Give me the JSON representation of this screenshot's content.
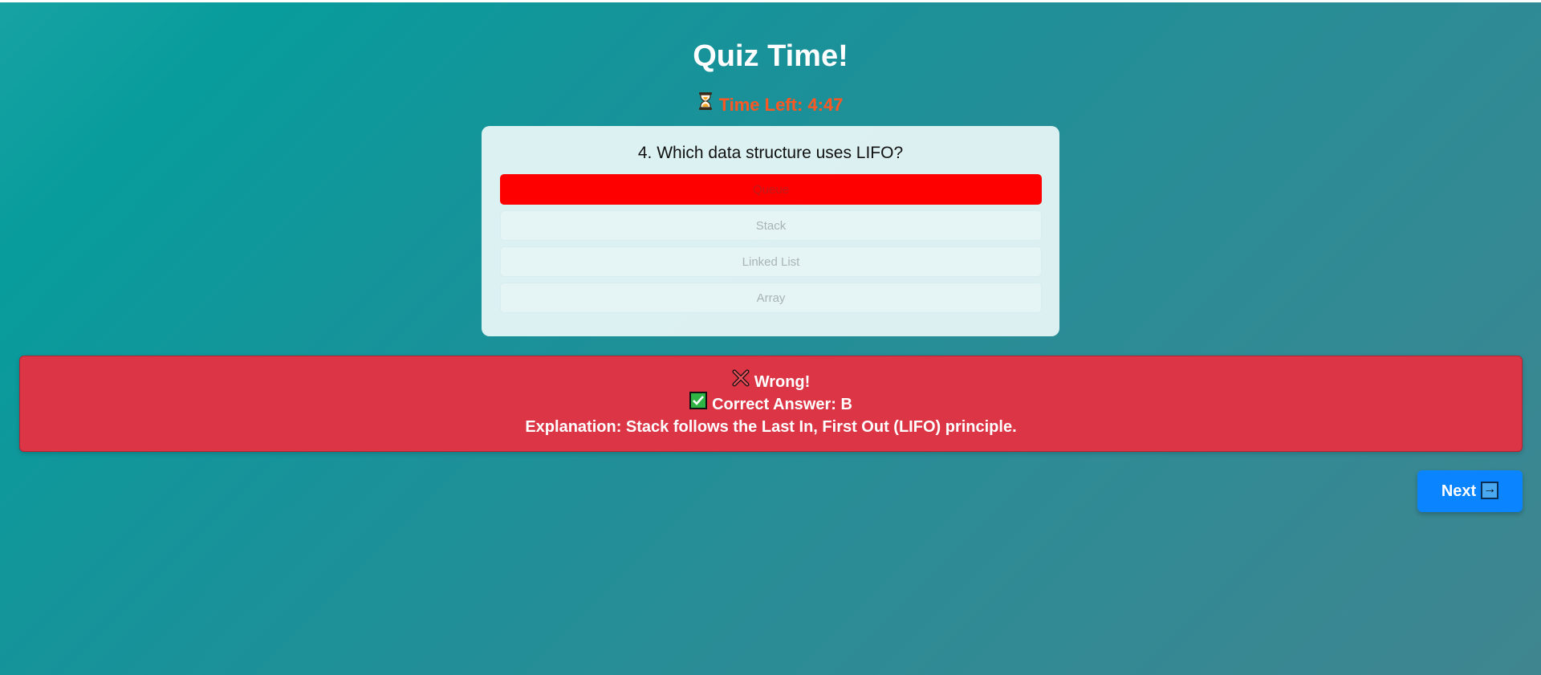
{
  "quiz": {
    "title": "Quiz Time!",
    "timer": {
      "icon": "hourglass-icon",
      "label": "Time Left: 4:47",
      "color": "#ff5722"
    },
    "question": {
      "text": "4. Which data structure uses LIFO?",
      "options": [
        {
          "label": "Queue",
          "selected": true
        },
        {
          "label": "Stack",
          "selected": false
        },
        {
          "label": "Linked List",
          "selected": false
        },
        {
          "label": "Array",
          "selected": false
        }
      ],
      "selected_color": "#ff0000"
    },
    "feedback": {
      "status_icon": "cross-icon",
      "status_text": "Wrong!",
      "correct_icon": "check-mark-icon",
      "correct_text": "Correct Answer: B",
      "explanation_label": "Explanation:",
      "explanation_text": "Stack follows the Last In, First Out (LIFO) principle.",
      "color": "#dc3545"
    },
    "next_button": {
      "label": "Next",
      "icon": "arrow-right-icon",
      "arrow": "→",
      "color": "#0a84ff"
    }
  }
}
